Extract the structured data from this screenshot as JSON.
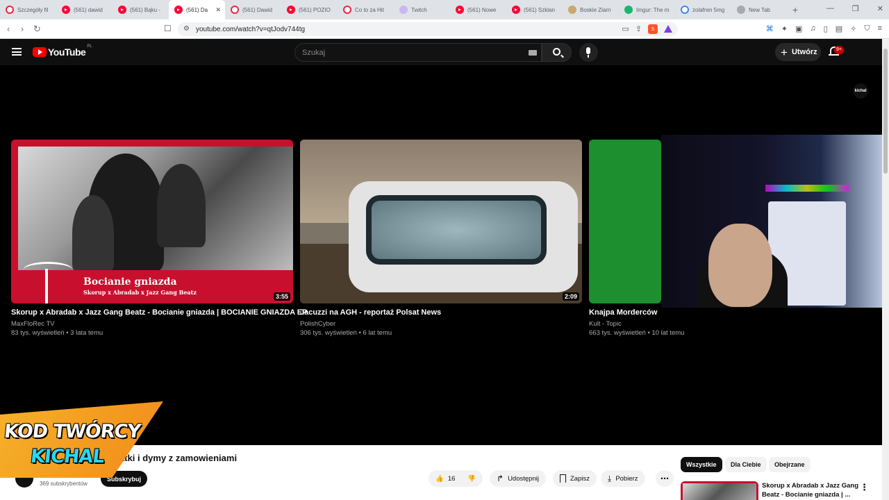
{
  "browser": {
    "tabs": [
      {
        "label": "Szczegóły fil",
        "icon": "ring"
      },
      {
        "label": "(561) dawid",
        "icon": "yt"
      },
      {
        "label": "(561) Bąku -",
        "icon": "yt"
      },
      {
        "label": "(561) Da",
        "icon": "yt",
        "active": true
      },
      {
        "label": "(561) Dawid",
        "icon": "ring"
      },
      {
        "label": "(561) POZIO",
        "icon": "yt"
      },
      {
        "label": "Co to za Hit",
        "icon": "ring"
      },
      {
        "label": "Twitch",
        "icon": "tw"
      },
      {
        "label": "(561) Nowe",
        "icon": "yt"
      },
      {
        "label": "(561) Szklan",
        "icon": "yt"
      },
      {
        "label": "Boskie Ziarn",
        "icon": "bz"
      },
      {
        "label": "Imgur: The m",
        "icon": "im"
      },
      {
        "label": "zolafren 5mg",
        "icon": "gg"
      },
      {
        "label": "New Tab",
        "icon": "nt"
      }
    ],
    "url": "youtube.com/watch?v=qtJodv744tg",
    "brave_count": "5"
  },
  "youtube": {
    "logo_text": "YouTube",
    "country_code": "PL",
    "search_placeholder": "Szukaj",
    "create_label": "Utwórz",
    "notifications_badge": "9+",
    "avatar_text": "kichal"
  },
  "end_screen": {
    "cards": [
      {
        "title": "Skorup x Abradab x Jazz Gang Beatz - Bocianie gniazda | BOCIANIE GNIAZDA EP",
        "channel": "MaxFloRec TV",
        "meta": "83 tys. wyświetleń • 3 lata temu",
        "duration": "3:55",
        "thumb_title": "Bocianie gniazda",
        "thumb_subtitle": "Skorup x Abradab x Jazz Gang Beatz"
      },
      {
        "title": "Jacuzzi na AGH - reportaż Polsat News",
        "channel": "PolishCyber",
        "meta": "306 tys. wyświetleń • 6 lat temu",
        "duration": "2:09"
      },
      {
        "title": "Knajpa Morderców",
        "channel": "Kult - Topic",
        "meta": "663 tys. wyświetleń • 10 lat temu"
      }
    ]
  },
  "overlay": {
    "line1": "KOD TWÓRCY",
    "line2": "KICHAL"
  },
  "video": {
    "title_visible": "atki i dymy z zamowieniami",
    "subscribers": "369 subskrybentów",
    "subscribe_label": "Subskrybuj",
    "likes": "16",
    "share_label": "Udostępnij",
    "save_label": "Zapisz",
    "download_label": "Pobierz"
  },
  "sidebar": {
    "chips": [
      "Wszystkie",
      "Dla Ciebie",
      "Obejrzane"
    ],
    "related_title": "Skorup x Abradab x Jazz Gang Beatz - Bocianie gniazda | ..."
  }
}
